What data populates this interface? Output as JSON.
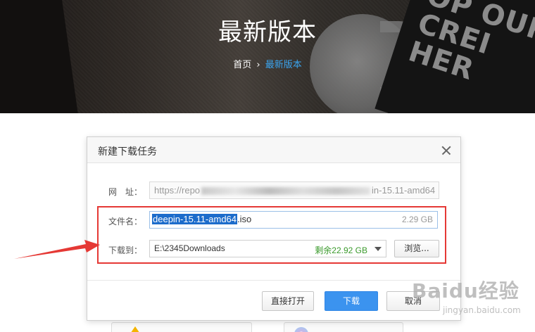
{
  "hero": {
    "title": "最新版本",
    "book_text": "OP OUR CREI HER",
    "breadcrumb": {
      "home": "首页",
      "separator": "›",
      "current": "最新版本"
    }
  },
  "dialog": {
    "title": "新建下载任务",
    "url_label": "网　址：",
    "url_value_start": "https://repo",
    "url_value_end": "in-15.11-amd64",
    "filename_label": "文件名：",
    "filename_selected": "deepin-15.11-amd64",
    "filename_ext": ".iso",
    "file_size": "2.29 GB",
    "save_to_label": "下载到：",
    "save_path": "E:\\2345Downloads",
    "free_space": "剩余22.92 GB",
    "browse_label": "浏览...",
    "open_direct_label": "直接打开",
    "download_label": "下载",
    "cancel_label": "取消"
  },
  "watermark": {
    "main": "Baidu经验",
    "sub": "jingyan.baidu.com"
  },
  "colors": {
    "highlight": "#e53935",
    "primary_button": "#3b93ef",
    "free_space": "#3a9a2b",
    "breadcrumb_current": "#3ba5f0",
    "selection": "#1c6ccb"
  }
}
